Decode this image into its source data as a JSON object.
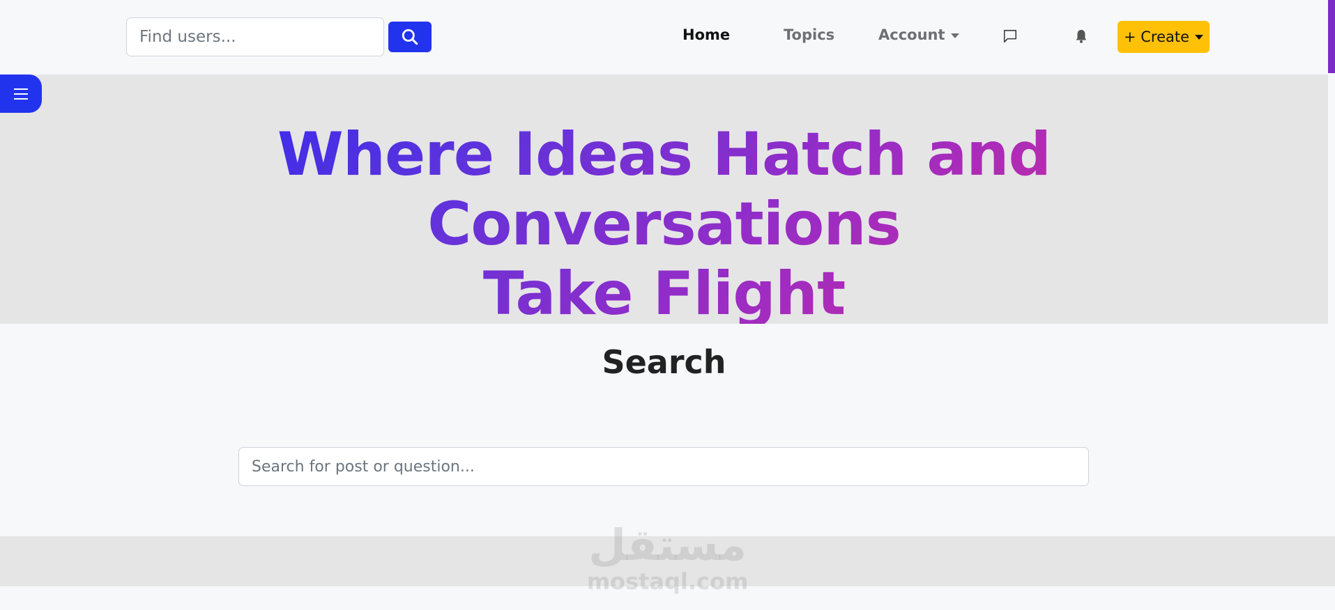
{
  "navbar": {
    "find_users_placeholder": "Find users...",
    "links": {
      "home": "Home",
      "topics": "Topics",
      "account": "Account"
    },
    "create_label": "+ Create"
  },
  "hero": {
    "title_line1": "Where Ideas Hatch and Conversations",
    "title_line2": "Take Flight"
  },
  "search_section": {
    "heading": "Search",
    "placeholder": "Search for post or question..."
  },
  "watermark": {
    "logo_text": "مستقل",
    "site": "mostaql.com"
  },
  "colors": {
    "primary": "#2233ee",
    "create": "#ffc107",
    "gradient_start": "#2626f2",
    "gradient_end": "#e92a86"
  }
}
